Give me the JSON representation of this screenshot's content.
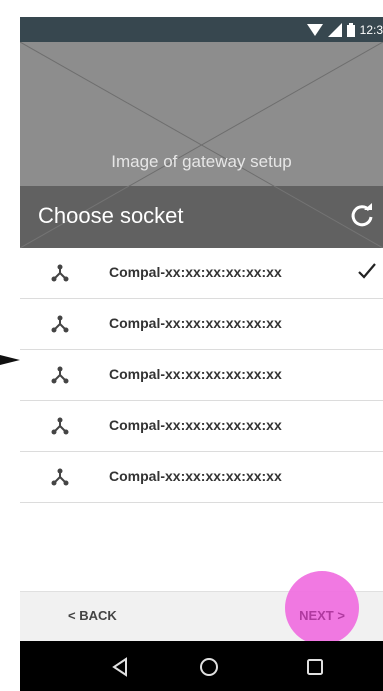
{
  "status_bar": {
    "time": "12:3",
    "icons": [
      "wifi-icon",
      "signal-icon",
      "battery-icon"
    ]
  },
  "hero": {
    "caption": "Image of gateway setup"
  },
  "choose_bar": {
    "title": "Choose socket",
    "refresh_icon": "refresh-icon"
  },
  "sockets": [
    {
      "label": "Compal-xx:xx:xx:xx:xx:xx",
      "selected": true
    },
    {
      "label": "Compal-xx:xx:xx:xx:xx:xx",
      "selected": false
    },
    {
      "label": "Compal-xx:xx:xx:xx:xx:xx",
      "selected": false
    },
    {
      "label": "Compal-xx:xx:xx:xx:xx:xx",
      "selected": false
    },
    {
      "label": "Compal-xx:xx:xx:xx:xx:xx",
      "selected": false
    }
  ],
  "bottom_bar": {
    "back_label": "< BACK",
    "next_label": "NEXT >"
  },
  "nav_bar": {
    "icons": [
      "back-triangle-icon",
      "home-circle-icon",
      "recents-square-icon"
    ]
  },
  "colors": {
    "status_bar": "#37474f",
    "hero": "#8d8d8d",
    "choose_bar": "#616161",
    "highlight": "#f06ee0"
  }
}
